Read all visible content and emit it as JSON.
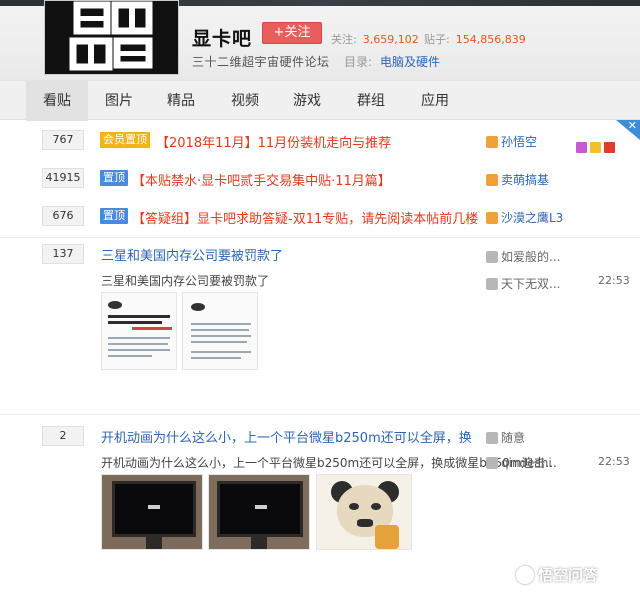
{
  "header": {
    "forum_name": "显卡吧",
    "follow_label": "+关注",
    "stats": [
      {
        "label": "关注:",
        "value": "3,659,102"
      },
      {
        "label": "贴子:",
        "value": "154,856,839"
      }
    ],
    "slogan": "三十二维超宇宙硬件论坛",
    "catalog_label": "目录:",
    "catalog_value": "电脑及硬件"
  },
  "nav": {
    "items": [
      "看贴",
      "图片",
      "精品",
      "视频",
      "游戏",
      "群组",
      "应用"
    ],
    "active_index": 0
  },
  "threads": [
    {
      "replies": "767",
      "tag": "会员置顶",
      "tag_kind": "vip",
      "title": "【2018年11月】11月份装机走向与推荐",
      "author": "孙悟空"
    },
    {
      "replies": "41915",
      "tag": "置顶",
      "tag_kind": "top",
      "title": "【本贴禁水·显卡吧贰手交易集中贴·11月篇】",
      "author": "卖萌搞基"
    },
    {
      "replies": "676",
      "tag": "置顶",
      "tag_kind": "top",
      "title": "【答疑组】显卡吧求助答疑-双11专贴，请先阅读本帖前几楼",
      "author": "沙漠之鹰L3"
    },
    {
      "replies": "137",
      "title": "三星和美国内存公司要被罚款了",
      "abstract": "三星和美国内存公司要被罚款了",
      "author": "如爱般的...",
      "last_author": "天下无双...",
      "time": "22:53"
    },
    {
      "replies": "2",
      "title": "开机动画为什么这么小，上一个平台微星b250m还可以全屏，换",
      "abstract": "开机动画为什么这么小，上一个平台微星b250m还可以全屏，换成微星b450m迫击...",
      "author": "随意",
      "last_author": "qindeshi",
      "time": "22:53"
    }
  ],
  "watermark": "悟空问答",
  "colors": {
    "accent_red": "#e2391d",
    "link_blue": "#2d64b3",
    "tag_vip": "#f5b31a",
    "tag_top": "#4b8ad8",
    "follow": "#e95d5d"
  }
}
